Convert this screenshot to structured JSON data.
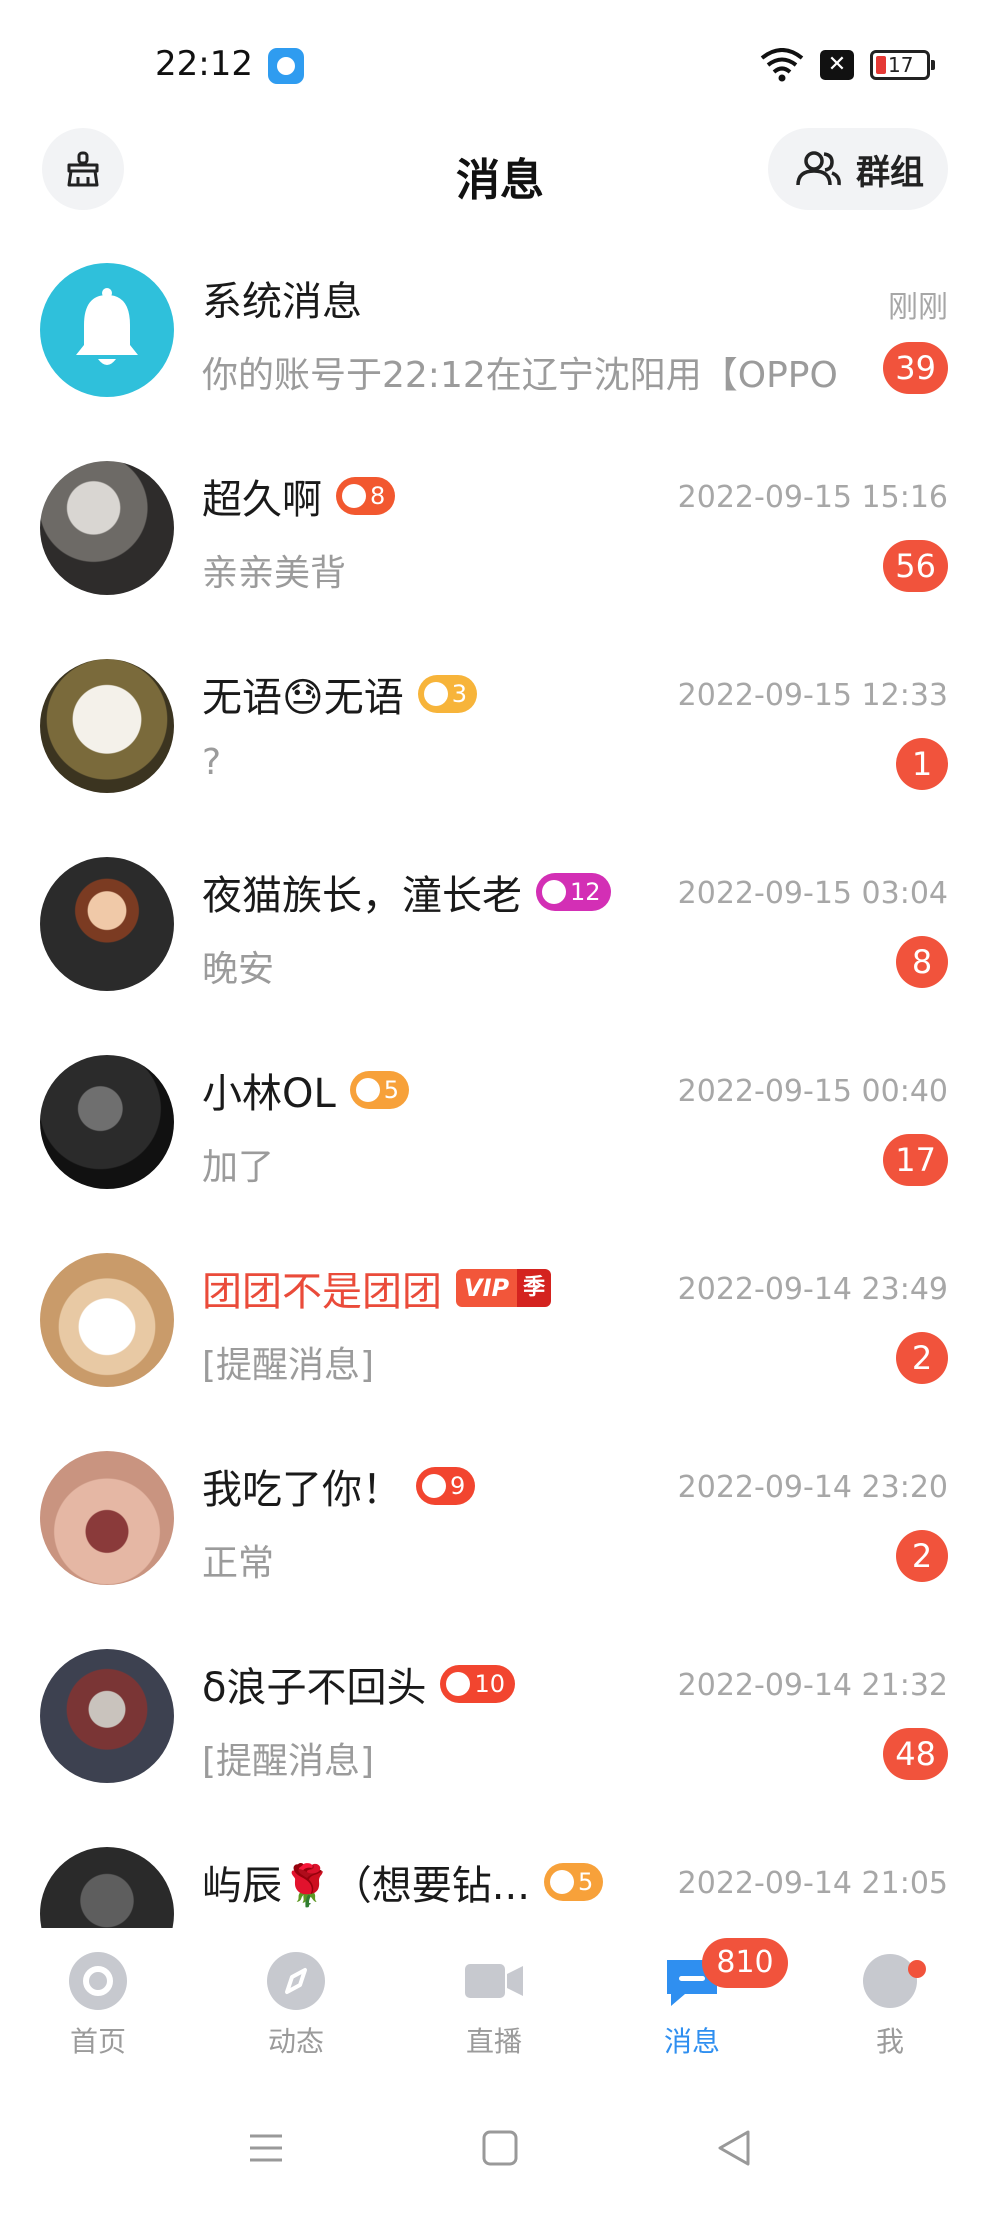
{
  "status_bar": {
    "time": "22:12",
    "battery_level": "17"
  },
  "header": {
    "title": "消息",
    "group_label": "群组"
  },
  "conversations": [
    {
      "name": "系统消息",
      "badge_type": "none",
      "level": "",
      "time": "刚刚",
      "preview": "你的账号于22:12在辽宁沈阳用【OPPO",
      "count": "39",
      "vip": false,
      "avatar_color": "#2fc0db"
    },
    {
      "name": "超久啊",
      "badge_type": "level",
      "level": "8",
      "badge_color": "#f2582f",
      "time": "2022-09-15 15:16",
      "preview": "亲亲美背",
      "count": "56",
      "vip": false
    },
    {
      "name": "无语😓无语",
      "badge_type": "level",
      "level": "3",
      "badge_color": "#f7b43a",
      "time": "2022-09-15 12:33",
      "preview": "?",
      "count": "1",
      "vip": false
    },
    {
      "name": "夜猫族长，潼长老",
      "badge_type": "level",
      "level": "12",
      "badge_color": "#d32fb5",
      "time": "2022-09-15 03:04",
      "preview": "晚安",
      "count": "8",
      "vip": false
    },
    {
      "name": "小林OL",
      "badge_type": "level",
      "level": "5",
      "badge_color": "#f7a13a",
      "time": "2022-09-15 00:40",
      "preview": "加了",
      "count": "17",
      "vip": false
    },
    {
      "name": "团团不是团团",
      "badge_type": "vip",
      "vip_label": "VIP",
      "vip_season": "季",
      "time": "2022-09-14 23:49",
      "preview": "[提醒消息]",
      "count": "2",
      "vip": true
    },
    {
      "name": "我吃了你！",
      "badge_type": "level",
      "level": "9",
      "badge_color": "#f2452f",
      "time": "2022-09-14 23:20",
      "preview": "正常",
      "count": "2",
      "vip": false
    },
    {
      "name": "δ浪子不回头",
      "badge_type": "level",
      "level": "10",
      "badge_color": "#f2452f",
      "time": "2022-09-14 21:32",
      "preview": "[提醒消息]",
      "count": "48",
      "vip": false
    },
    {
      "name": "屿辰🌹（想要钻...",
      "badge_type": "level",
      "level": "5",
      "badge_color": "#f7a13a",
      "time": "2022-09-14 21:05",
      "preview": "",
      "count": "",
      "vip": false
    }
  ],
  "bottom_nav": [
    {
      "label": "首页",
      "icon": "home-icon",
      "active": false
    },
    {
      "label": "动态",
      "icon": "compass-icon",
      "active": false
    },
    {
      "label": "直播",
      "icon": "video-icon",
      "active": false
    },
    {
      "label": "消息",
      "icon": "message-icon",
      "active": true,
      "badge": "810"
    },
    {
      "label": "我",
      "icon": "profile-icon",
      "active": false,
      "dot": true
    }
  ],
  "colors": {
    "accent": "#2f8ff0",
    "badge_red": "#f1533c",
    "vip_name": "#ea4b3a"
  }
}
